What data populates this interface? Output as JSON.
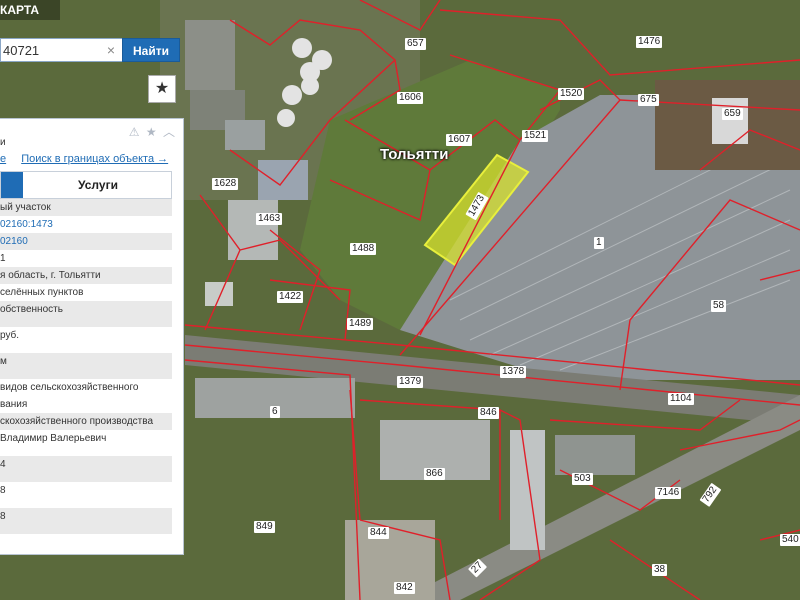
{
  "header": {
    "title": "КАРТА"
  },
  "search": {
    "value": "40721",
    "button_label": "Найти",
    "clear_glyph": "×"
  },
  "favorites": {
    "icon": "star-icon",
    "glyph": "★"
  },
  "city_label": "Тольятти",
  "parcel_labels": [
    "657",
    "1476",
    "1606",
    "1520",
    "675",
    "659",
    "1607",
    "1521",
    "1628",
    "1473",
    "1463",
    "1488",
    "1",
    "1422",
    "58",
    "1489",
    "1378",
    "1379",
    "1104",
    "6",
    "846",
    "866",
    "503",
    "7146",
    "792",
    "849",
    "844",
    "842",
    "27",
    "38",
    "540"
  ],
  "panel": {
    "tool_icons": [
      "warning-icon",
      "star-icon",
      "collapse-icon"
    ],
    "tool_glyphs": [
      "⚠",
      "★",
      "︿"
    ],
    "title_fragment": "и",
    "link_left": "е",
    "link_search": "Поиск в границах объекта →",
    "tab_services": "Услуги",
    "rows": [
      {
        "text": "ый участок",
        "alt": true,
        "link": false
      },
      {
        "text": "02160:1473",
        "alt": false,
        "link": true
      },
      {
        "text": "02160",
        "alt": true,
        "link": true
      },
      {
        "text": "1",
        "alt": false,
        "link": false
      },
      {
        "text": "я область, г. Тольятти",
        "alt": true,
        "link": false
      },
      {
        "text": "селённых пунктов",
        "alt": false,
        "link": false
      },
      {
        "text": "обственность",
        "alt": true,
        "link": false
      },
      {
        "text": "руб.",
        "alt": false,
        "link": false
      },
      {
        "text": "м",
        "alt": true,
        "link": false
      },
      {
        "text": "видов сельскохозяйственного",
        "alt": false,
        "link": false
      },
      {
        "text": "вания",
        "alt": false,
        "link": false
      },
      {
        "text": "скохозяйственного производства",
        "alt": true,
        "link": false
      },
      {
        "text": "Владимир Валерьевич",
        "alt": false,
        "link": false
      },
      {
        "text": "4",
        "alt": true,
        "link": false
      },
      {
        "text": "8",
        "alt": false,
        "link": false
      },
      {
        "text": "8",
        "alt": true,
        "link": false
      }
    ]
  }
}
